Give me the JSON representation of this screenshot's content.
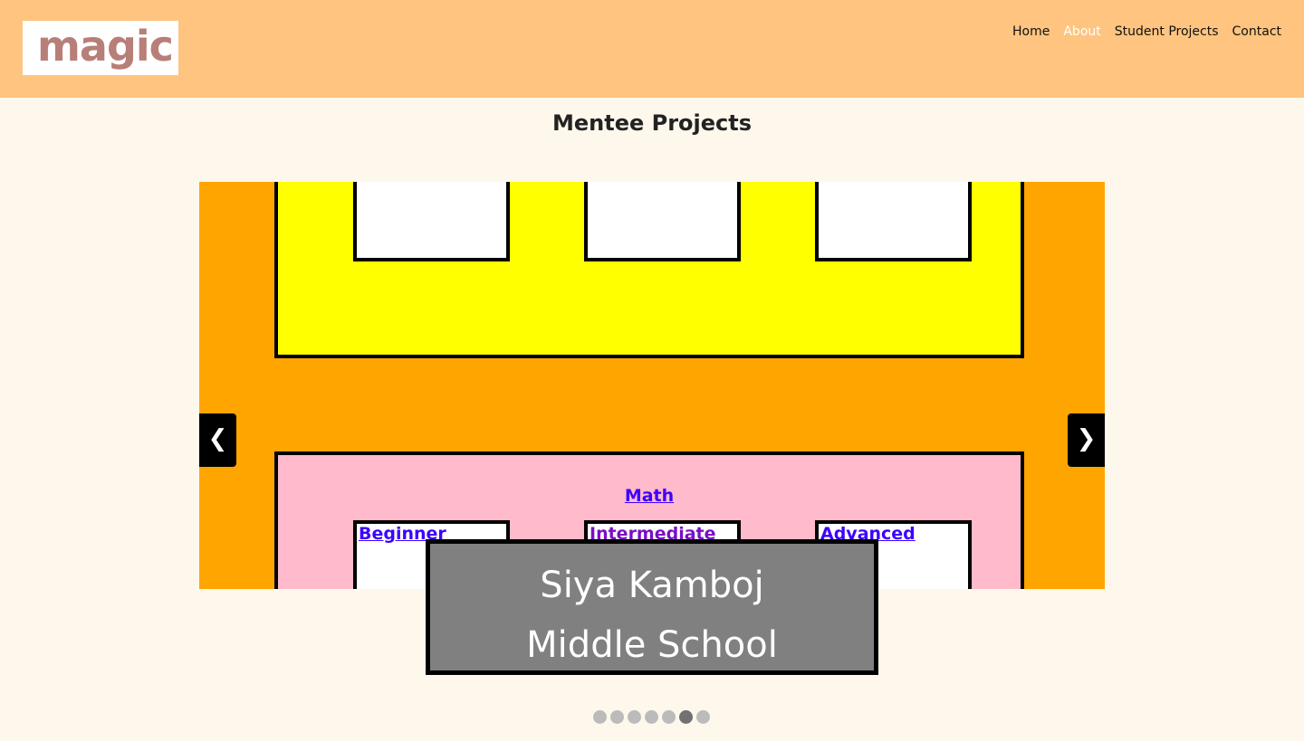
{
  "logo": {
    "text": "magic"
  },
  "nav": [
    {
      "label": "Home",
      "active": false
    },
    {
      "label": "About",
      "active": true
    },
    {
      "label": "Student Projects",
      "active": false
    },
    {
      "label": "Contact",
      "active": false
    }
  ],
  "page_title": "Mentee Projects",
  "slide": {
    "math_link": "Math",
    "levels": [
      "Beginner",
      "Intermediate",
      "Advanced"
    ]
  },
  "carousel": {
    "prev": "❮",
    "next": "❯",
    "caption": {
      "name": "Siya Kamboj",
      "school": "Middle School"
    },
    "slide_count": 7,
    "current_slide": 6
  },
  "colors": {
    "header": "#ffc47f",
    "page_bg": "#fef8ec",
    "slide_bg": "#ffa500",
    "yellow_panel": "#ffff00",
    "pink_panel": "#ffbacb",
    "link": "#3d00ff",
    "caption_bg": "#808080"
  }
}
